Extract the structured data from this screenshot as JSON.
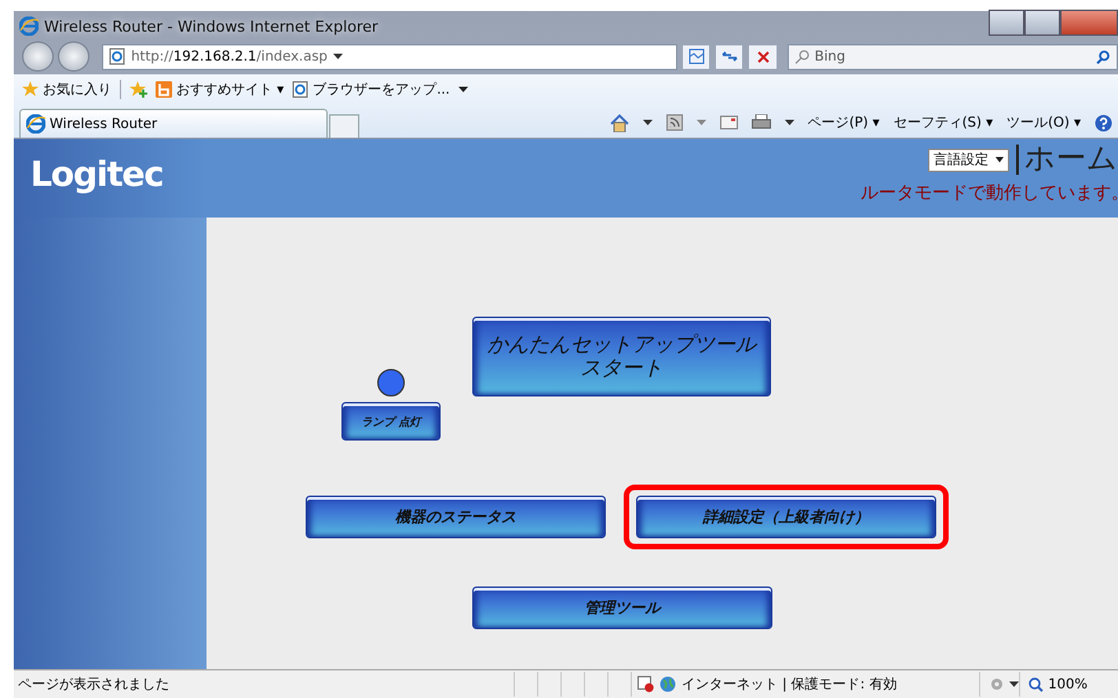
{
  "window": {
    "title": "Wireless Router - Windows Internet Explorer"
  },
  "address_bar": {
    "url_prefix": "http://",
    "url_host": "192.168.2.1",
    "url_path": "/index.asp"
  },
  "search": {
    "placeholder": "Bing"
  },
  "favorites_bar": [
    {
      "kind": "favorites",
      "label": "お気に入り"
    },
    {
      "kind": "suggested",
      "label": "おすすめサイト ▾"
    },
    {
      "kind": "page",
      "label": "ブラウザーをアップ..."
    }
  ],
  "tabs": [
    {
      "label": "Wireless Router",
      "selected": true
    }
  ],
  "command_bar": [
    "ページ(P) ▾",
    "セーフティ(S) ▾",
    "ツール(O) ▾"
  ],
  "page": {
    "logo": "Logitec",
    "language_select": "言語設定",
    "heading": "ホーム",
    "mode_message": "ルータモードで動作しています。",
    "lamp": {
      "on": true,
      "label": "ランプ 点灯"
    },
    "buttons": [
      {
        "kind": "large",
        "label_lines": [
          "かんたんセットアップツール",
          "スタート"
        ],
        "highlighted": false
      },
      {
        "kind": "wide",
        "label": "機器のステータス",
        "highlighted": false
      },
      {
        "kind": "wide",
        "label": "詳細設定（上級者向け）",
        "highlighted": true
      },
      {
        "kind": "wide",
        "label": "管理ツール",
        "highlighted": false
      }
    ]
  },
  "status_bar": {
    "message": "ページが表示されました",
    "zone": "インターネット | 保護モード: 有効",
    "zoom": "100%"
  }
}
